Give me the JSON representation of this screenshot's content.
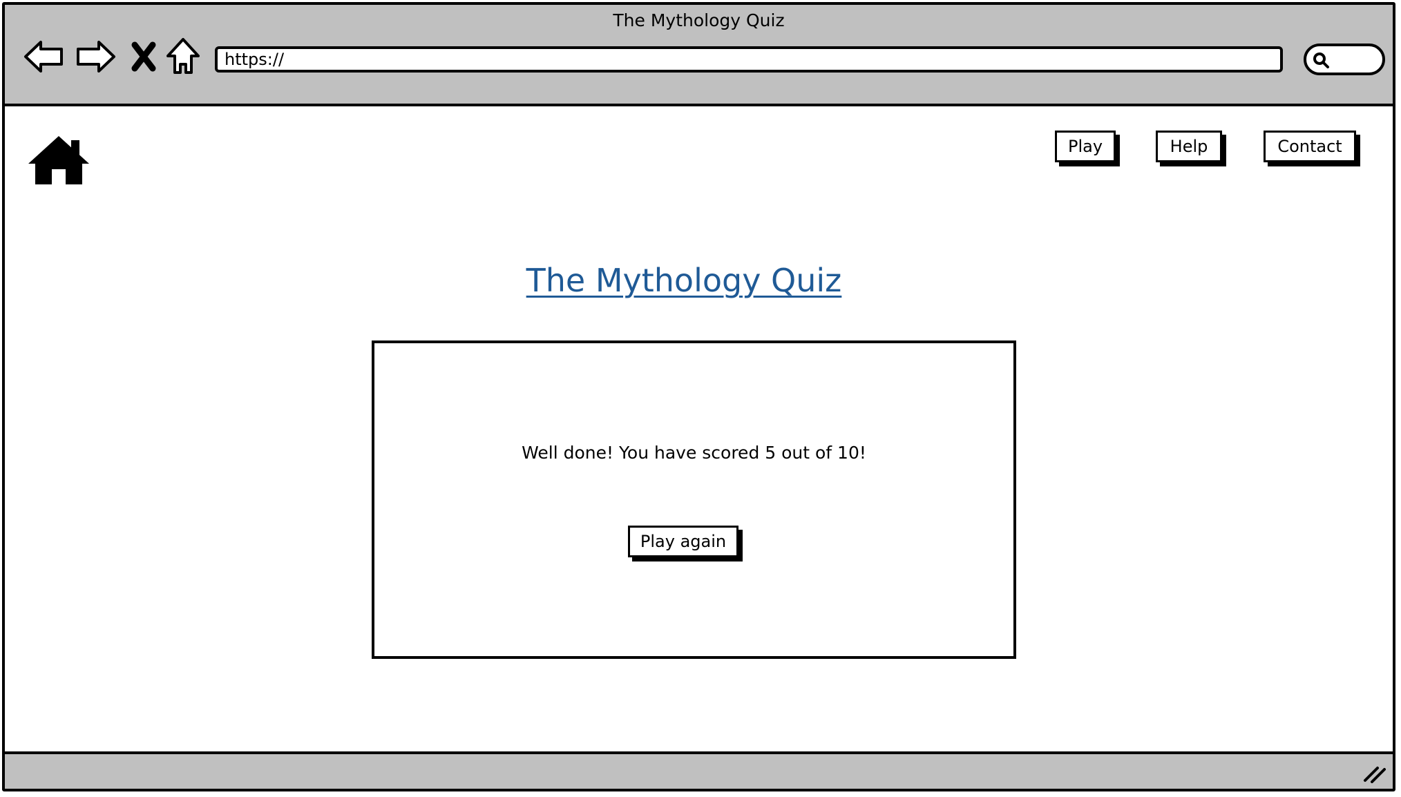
{
  "browser": {
    "window_title": "The Mythology Quiz",
    "url": "https://",
    "icons": [
      "back-icon",
      "forward-icon",
      "close-icon",
      "home-icon",
      "search-icon"
    ]
  },
  "nav": {
    "logo_icon": "house-icon",
    "links": [
      {
        "label": "Play"
      },
      {
        "label": "Help"
      },
      {
        "label": "Contact"
      }
    ]
  },
  "main": {
    "title": "The Mythology Quiz",
    "result_message": "Well done! You have scored 5 out of 10!",
    "play_again_label": "Play again"
  },
  "colors": {
    "title": "#1f5a96",
    "chrome": "#c0c0c0"
  }
}
